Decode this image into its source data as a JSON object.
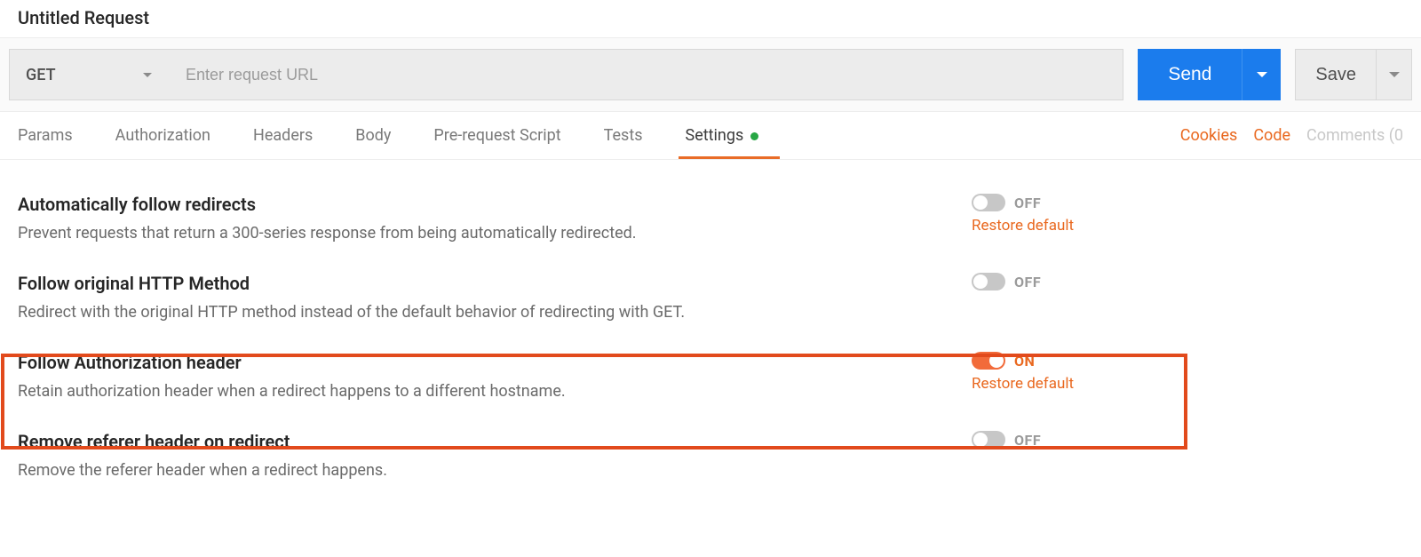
{
  "request_title": "Untitled Request",
  "method": "GET",
  "url_placeholder": "Enter request URL",
  "send_label": "Send",
  "save_label": "Save",
  "tabs": {
    "params": "Params",
    "authorization": "Authorization",
    "headers": "Headers",
    "body": "Body",
    "prerequest": "Pre-request Script",
    "tests": "Tests",
    "settings": "Settings"
  },
  "active_tab": "settings",
  "settings_has_indicator": true,
  "right_links": {
    "cookies": "Cookies",
    "code": "Code",
    "comments": "Comments (0"
  },
  "settings": [
    {
      "key": "follow_redirects",
      "title": "Automatically follow redirects",
      "desc": "Prevent requests that return a 300-series response from being automatically redirected.",
      "state": "OFF",
      "on": false,
      "restore": "Restore default",
      "show_restore": true
    },
    {
      "key": "follow_original_method",
      "title": "Follow original HTTP Method",
      "desc": "Redirect with the original HTTP method instead of the default behavior of redirecting with GET.",
      "state": "OFF",
      "on": false,
      "restore": "",
      "show_restore": false
    },
    {
      "key": "follow_auth_header",
      "title": "Follow Authorization header",
      "desc": "Retain authorization header when a redirect happens to a different hostname.",
      "state": "ON",
      "on": true,
      "restore": "Restore default",
      "show_restore": true
    },
    {
      "key": "remove_referer",
      "title": "Remove referer header on redirect",
      "desc": "Remove the referer header when a redirect happens.",
      "state": "OFF",
      "on": false,
      "restore": "",
      "show_restore": false
    }
  ]
}
